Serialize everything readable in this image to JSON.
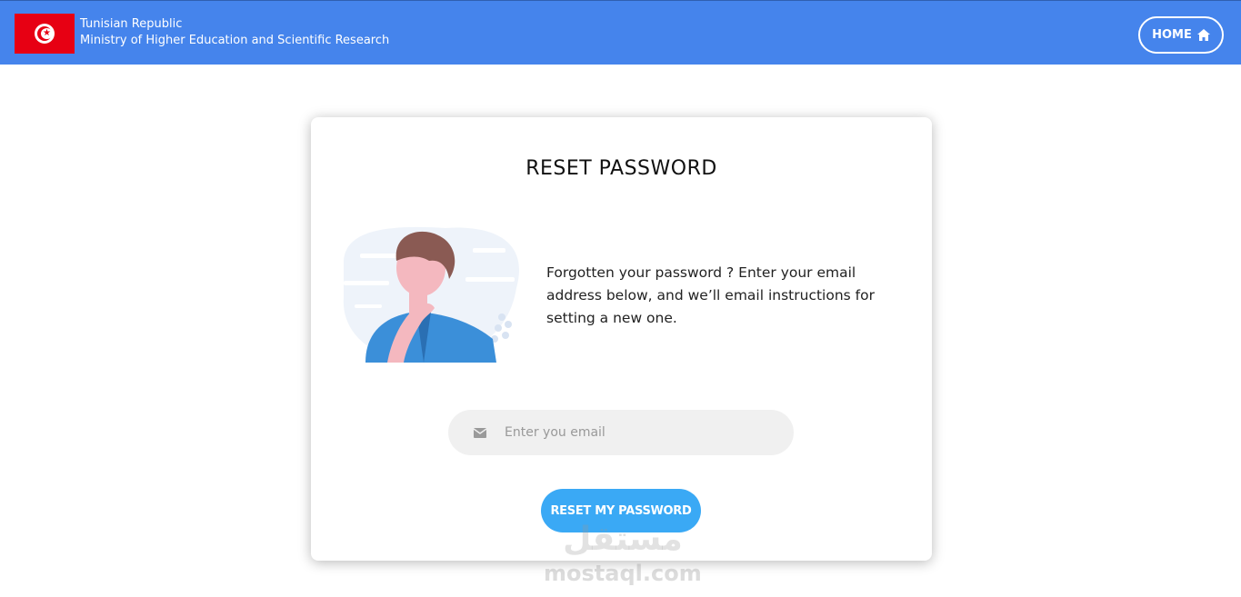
{
  "header": {
    "country": "Tunisian Republic",
    "ministry": "Ministry of Higher Education and Scientific Research",
    "home_label": "HOME",
    "colors": {
      "bar": "#4584ec",
      "flag_red": "#e70013"
    }
  },
  "card": {
    "title": "RESET PASSWORD",
    "description": "Forgotten your password ? Enter your email address below, and we’ll email instructions for setting a new one.",
    "email_placeholder": "Enter you email",
    "reset_label": "RESET MY PASSWORD",
    "colors": {
      "button": "#3aa9f5",
      "input_bg": "#f0f0f0"
    }
  },
  "watermark": {
    "arabic": "مستقل",
    "latin": "mostaql.com"
  },
  "icons": [
    "tunisia-flag-icon",
    "home-icon",
    "envelope-icon"
  ]
}
